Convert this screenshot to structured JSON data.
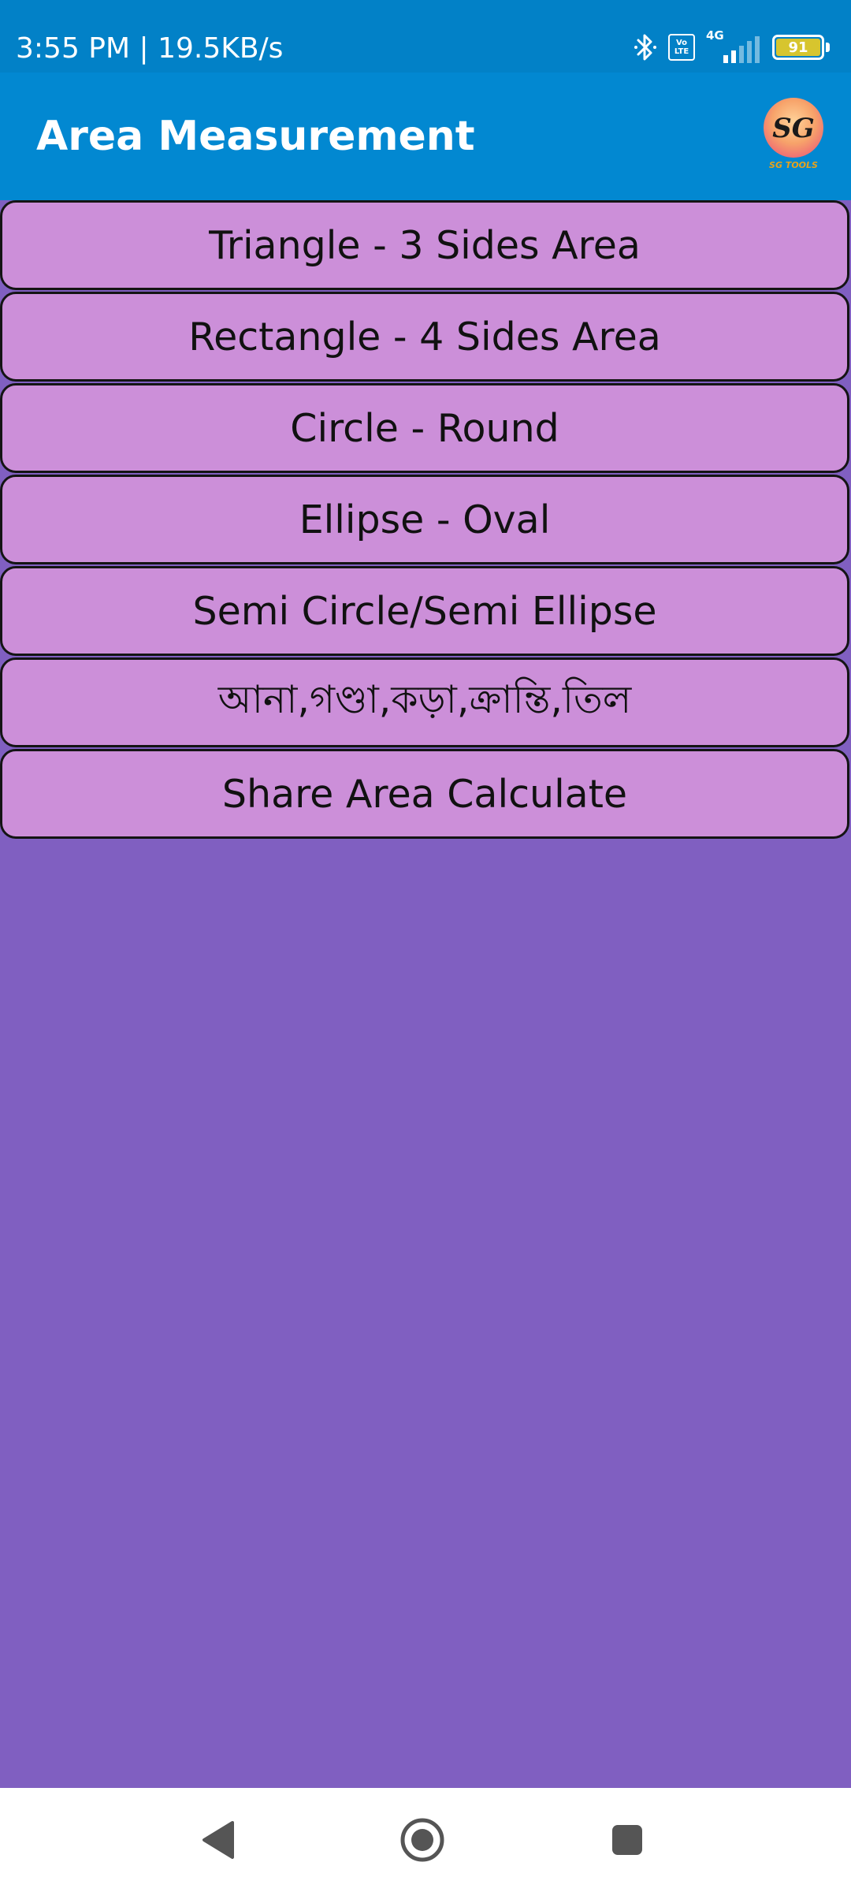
{
  "status_bar": {
    "time_text": "3:55 PM | 19.5KB/s",
    "volte_line1": "Vo",
    "volte_line2": "LTE",
    "network": "4G",
    "battery_level": "91",
    "icons": [
      "bluetooth-icon",
      "volte-icon",
      "signal-icon",
      "battery-icon"
    ]
  },
  "app_bar": {
    "title": "Area Measurement",
    "logo_text": "SG",
    "logo_caption": "SG TOOLS",
    "color": "#0288d1"
  },
  "menu": {
    "items": [
      {
        "label": "Triangle - 3 Sides Area"
      },
      {
        "label": "Rectangle - 4 Sides Area"
      },
      {
        "label": "Circle - Round"
      },
      {
        "label": "Ellipse - Oval"
      },
      {
        "label": "Semi Circle/Semi Ellipse"
      },
      {
        "label": "আনা,গণ্ডা,কড়া,ক্রান্তি,তিল"
      },
      {
        "label": "Share Area Calculate"
      }
    ],
    "button_color": "#cc8fd9"
  },
  "background_color": "#805fc1",
  "nav_bar": {
    "icons": [
      "back-icon",
      "home-icon",
      "recents-icon"
    ]
  }
}
